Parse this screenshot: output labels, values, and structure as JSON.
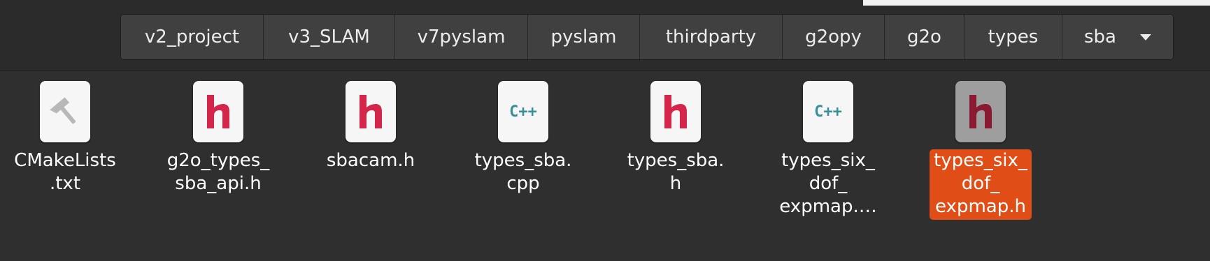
{
  "breadcrumbs": [
    "v2_project",
    "v3_SLAM",
    "v7pyslam",
    "pyslam",
    "thirdparty",
    "g2opy",
    "g2o",
    "types",
    "sba"
  ],
  "files": [
    {
      "lines": [
        "CMakeLists",
        ".txt"
      ],
      "icon": "hammer-icon",
      "selected": false
    },
    {
      "lines": [
        "g2o_types_",
        "sba_api.h"
      ],
      "icon": "header-file-icon",
      "selected": false
    },
    {
      "lines": [
        "sbacam.h"
      ],
      "icon": "header-file-icon",
      "selected": false
    },
    {
      "lines": [
        "types_sba.",
        "cpp"
      ],
      "icon": "cpp-file-icon",
      "selected": false
    },
    {
      "lines": [
        "types_sba.",
        "h"
      ],
      "icon": "header-file-icon",
      "selected": false
    },
    {
      "lines": [
        "types_six_",
        "dof_",
        "expmap.…"
      ],
      "icon": "cpp-file-icon",
      "selected": false
    },
    {
      "lines": [
        "types_six_",
        "dof_",
        "expmap.h"
      ],
      "icon": "header-file-icon",
      "selected": true
    }
  ],
  "colors": {
    "selection": "#e04d16",
    "header_glyph": "#d6254a",
    "cpp_glyph": "#3b8f96"
  }
}
